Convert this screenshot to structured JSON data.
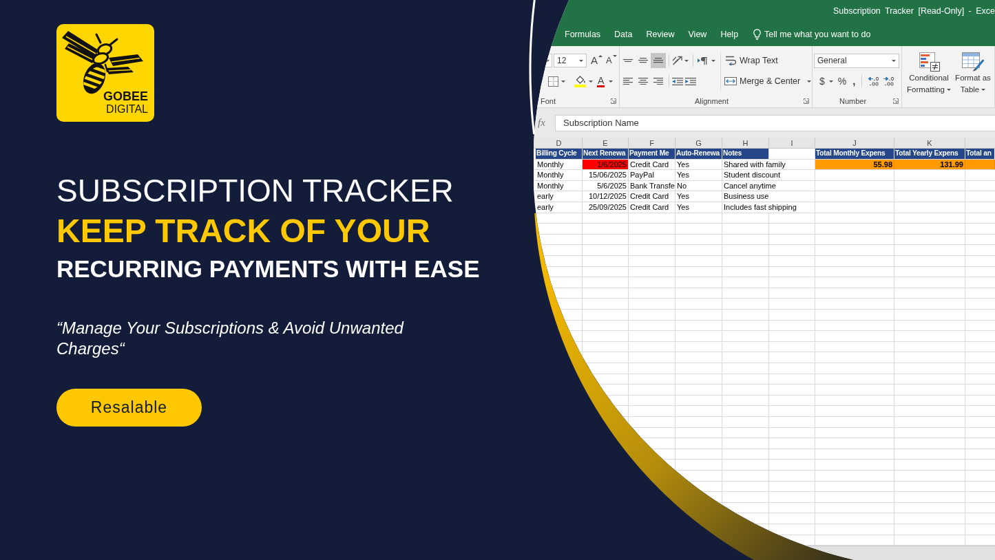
{
  "brand": {
    "name": "GOBEE",
    "tagline": "DIGITAL"
  },
  "headline": {
    "title": "SUBSCRIPTION TRACKER",
    "highlight": "KEEP TRACK OF YOUR",
    "subtitle": "RECURRING PAYMENTS WITH EASE"
  },
  "quote": "“Manage Your Subscriptions & Avoid Unwanted Charges“",
  "cta_button": {
    "label": "Resalable"
  },
  "spreadsheet": {
    "window": {
      "title": "Subscription Tracker [Read-Only] - Exce"
    },
    "menu_tabs": [
      {
        "label": "Formulas",
        "selected": false
      },
      {
        "label": "Data",
        "selected": false
      },
      {
        "label": "Review",
        "selected": false
      },
      {
        "label": "View",
        "selected": false
      },
      {
        "label": "Help",
        "selected": false
      }
    ],
    "tell_me": {
      "placeholder": "Tell me what you want to do"
    },
    "ribbon": {
      "font": {
        "label": "Font",
        "size": "12",
        "grow_glyph": "A",
        "shrink_glyph": "A",
        "color_glyph": "A"
      },
      "alignment": {
        "label": "Alignment",
        "vertical_align": [
          {
            "kind": "top",
            "selected": false
          },
          {
            "kind": "middle",
            "selected": false
          },
          {
            "kind": "bottom",
            "selected": true
          }
        ],
        "wrap_text": "Wrap Text",
        "merge": "Merge & Center"
      },
      "number": {
        "label": "Number",
        "format": "General",
        "currency": "$",
        "percent": "%",
        "comma": ","
      },
      "styles": [
        {
          "kind": "conditional",
          "label": "Conditional Formatting"
        },
        {
          "kind": "table",
          "label": "Format as Table"
        }
      ]
    },
    "formula_bar": {
      "function_glyph": "fx",
      "value": "Subscription Name"
    },
    "sheet": {
      "columns": [
        "D",
        "E",
        "F",
        "G",
        "H",
        "I",
        "J",
        "K"
      ],
      "table_headers": [
        "Billing Cycle",
        "Next Renewa",
        "Payment Me",
        "Auto-Renewa",
        "Notes"
      ],
      "rows": [
        {
          "cells": [
            {
              "text": "Monthly",
              "highlighted": false
            },
            {
              "text": "1/6/2025",
              "highlighted": true
            },
            {
              "text": "Credit Card",
              "highlighted": false
            },
            {
              "text": "Yes",
              "highlighted": false
            },
            {
              "text": "Shared with family",
              "highlighted": false
            }
          ]
        },
        {
          "cells": [
            {
              "text": "Monthly",
              "highlighted": false
            },
            {
              "text": "15/06/2025",
              "highlighted": false
            },
            {
              "text": "PayPal",
              "highlighted": false
            },
            {
              "text": "Yes",
              "highlighted": false
            },
            {
              "text": "Student discount",
              "highlighted": false
            }
          ]
        },
        {
          "cells": [
            {
              "text": "Monthly",
              "highlighted": false
            },
            {
              "text": "5/6/2025",
              "highlighted": false
            },
            {
              "text": "Bank Transfe",
              "highlighted": false
            },
            {
              "text": "No",
              "highlighted": false
            },
            {
              "text": "Cancel anytime",
              "highlighted": false
            }
          ]
        },
        {
          "cells": [
            {
              "text": "early",
              "highlighted": false
            },
            {
              "text": "10/12/2025",
              "highlighted": false
            },
            {
              "text": "Credit Card",
              "highlighted": false
            },
            {
              "text": "Yes",
              "highlighted": false
            },
            {
              "text": "Business use",
              "highlighted": false
            }
          ]
        },
        {
          "cells": [
            {
              "text": "early",
              "highlighted": false
            },
            {
              "text": "25/09/2025",
              "highlighted": false
            },
            {
              "text": "Credit Card",
              "highlighted": false
            },
            {
              "text": "Yes",
              "highlighted": false
            },
            {
              "text": "Includes fast shipping",
              "highlighted": false
            }
          ]
        }
      ],
      "summary": [
        {
          "header": "Total Monthly Expens",
          "value": "55.98"
        },
        {
          "header": "Total Yearly Expens",
          "value": "131.99"
        },
        {
          "header": "Total an"
        }
      ]
    }
  }
}
